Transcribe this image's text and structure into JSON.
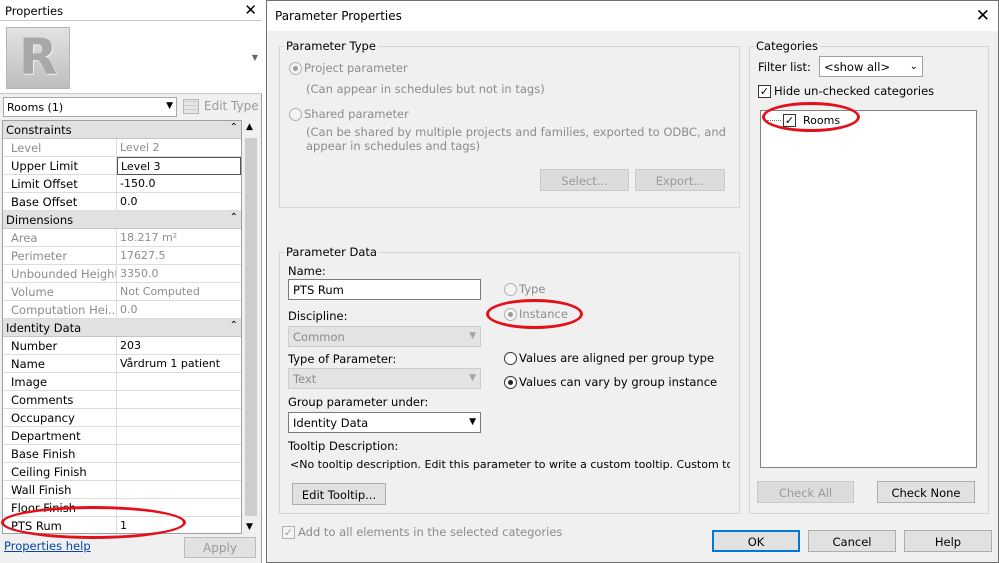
{
  "properties": {
    "title": "Properties",
    "close_glyph": "✕",
    "logo_letter": "R",
    "type_selector": "Rooms (1)",
    "edit_type": "Edit Type",
    "groups": [
      {
        "label": "Constraints",
        "rows": [
          {
            "name": "Level",
            "value": "Level 2",
            "readonly": true
          },
          {
            "name": "Upper Limit",
            "value": "Level 3",
            "selected": true
          },
          {
            "name": "Limit Offset",
            "value": "-150.0"
          },
          {
            "name": "Base Offset",
            "value": "0.0"
          }
        ]
      },
      {
        "label": "Dimensions",
        "rows": [
          {
            "name": "Area",
            "value": "18.217 m²",
            "readonly": true
          },
          {
            "name": "Perimeter",
            "value": "17627.5",
            "readonly": true
          },
          {
            "name": "Unbounded Height",
            "value": "3350.0",
            "readonly": true
          },
          {
            "name": "Volume",
            "value": "Not Computed",
            "readonly": true
          },
          {
            "name": "Computation Hei...",
            "value": "0.0",
            "readonly": true
          }
        ]
      },
      {
        "label": "Identity Data",
        "rows": [
          {
            "name": "Number",
            "value": "203"
          },
          {
            "name": "Name",
            "value": "Vårdrum 1 patient"
          },
          {
            "name": "Image",
            "value": ""
          },
          {
            "name": "Comments",
            "value": ""
          },
          {
            "name": "Occupancy",
            "value": ""
          },
          {
            "name": "Department",
            "value": ""
          },
          {
            "name": "Base Finish",
            "value": ""
          },
          {
            "name": "Ceiling Finish",
            "value": ""
          },
          {
            "name": "Wall Finish",
            "value": ""
          },
          {
            "name": "Floor Finish",
            "value": ""
          },
          {
            "name": "PTS Rum",
            "value": "1"
          }
        ]
      }
    ],
    "collapse_glyph": "⌃",
    "help_link": "Properties help",
    "apply": "Apply"
  },
  "dialog": {
    "title": "Parameter Properties",
    "close_glyph": "✕",
    "parameter_type": {
      "label": "Parameter Type",
      "project_parameter": "Project parameter",
      "project_desc": "(Can appear in schedules but not in tags)",
      "shared_parameter": "Shared parameter",
      "shared_desc_1": "(Can be shared by multiple projects and families, exported to ODBC, and",
      "shared_desc_2": "appear in schedules and tags)",
      "select": "Select...",
      "export": "Export..."
    },
    "parameter_data": {
      "label": "Parameter Data",
      "name_label": "Name:",
      "name_value": "PTS Rum",
      "type_option": "Type",
      "instance_option": "Instance",
      "discipline_label": "Discipline:",
      "discipline_value": "Common",
      "type_of_param_label": "Type of Parameter:",
      "type_of_param_value": "Text",
      "aligned_option": "Values are aligned per group type",
      "vary_option": "Values can vary by group instance",
      "group_under_label": "Group parameter under:",
      "group_under_value": "Identity Data",
      "tooltip_label": "Tooltip Description:",
      "tooltip_value": "<No tooltip description. Edit this parameter to write a custom tooltip. Custom tooltips hav...",
      "edit_tooltip": "Edit Tooltip..."
    },
    "add_to_all": "Add to all elements in the selected categories",
    "categories": {
      "label": "Categories",
      "filter_label": "Filter list:",
      "filter_value": "<show all>",
      "hide_unchecked": "Hide un-checked categories",
      "items": [
        "Rooms"
      ],
      "check_all": "Check All",
      "check_none": "Check None"
    },
    "ok": "OK",
    "cancel": "Cancel",
    "help": "Help"
  },
  "colors": {
    "annotation": "#e3101a",
    "accent": "#0078d7"
  }
}
